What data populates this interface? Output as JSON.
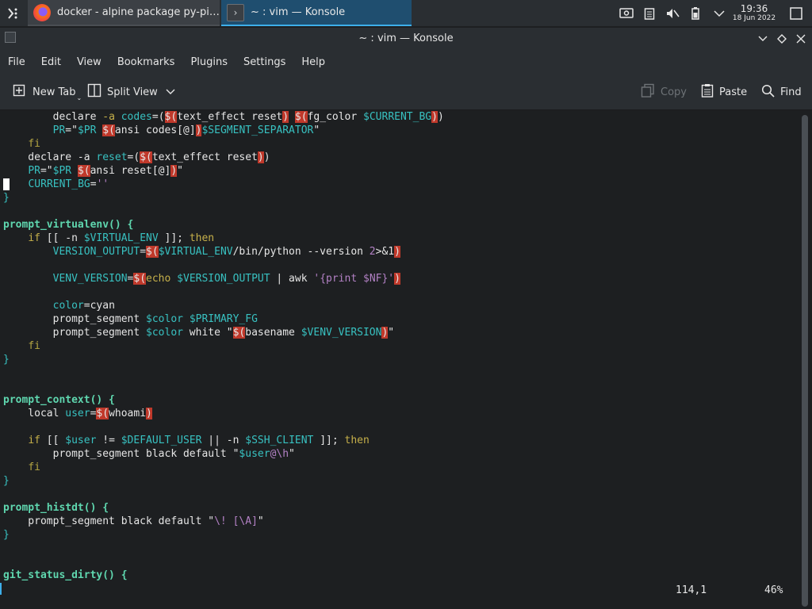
{
  "taskbar": {
    "tasks": [
      {
        "label": "docker - alpine package py-pip m...",
        "icon": "firefox-icon"
      },
      {
        "label": "~ : vim — Konsole",
        "icon": "konsole-icon"
      }
    ],
    "clock_time": "19:36",
    "clock_date": "18 Jun 2022"
  },
  "window": {
    "title": "~ : vim — Konsole"
  },
  "menubar": {
    "items": [
      "File",
      "Edit",
      "View",
      "Bookmarks",
      "Plugins",
      "Settings",
      "Help"
    ]
  },
  "toolbar": {
    "new_tab": "New Tab",
    "split_view": "Split View",
    "copy": "Copy",
    "paste": "Paste",
    "find": "Find"
  },
  "terminal": {
    "lines": [
      "        declare -a codes=($(text_effect reset) $(fg_color $CURRENT_BG))",
      "        PR=\"$PR $(ansi codes[@])$SEGMENT_SEPARATOR\"",
      "    fi",
      "    declare -a reset=($(text_effect reset))",
      "    PR=\"$PR $(ansi reset[@])\"",
      "    CURRENT_BG=''",
      "}",
      "",
      "prompt_virtualenv() {",
      "    if [[ -n $VIRTUAL_ENV ]]; then",
      "        VERSION_OUTPUT=$($VIRTUAL_ENV/bin/python --version 2>&1)",
      "",
      "        VENV_VERSION=$(echo $VERSION_OUTPUT | awk '{print $NF}')",
      "",
      "        color=cyan",
      "        prompt_segment $color $PRIMARY_FG",
      "        prompt_segment $color white \"$(basename $VENV_VERSION)\"",
      "    fi",
      "}",
      "",
      "",
      "prompt_context() {",
      "    local user=$(whoami)",
      "",
      "    if [[ $user != $DEFAULT_USER || -n $SSH_CLIENT ]]; then",
      "        prompt_segment black default \"$user@\\h\"",
      "    fi",
      "}",
      "",
      "prompt_histdt() {",
      "    prompt_segment black default \"\\! [\\A]\"",
      "}",
      "",
      "",
      "git_status_dirty() {"
    ],
    "status_position": "114,1",
    "status_percent": "46%"
  }
}
